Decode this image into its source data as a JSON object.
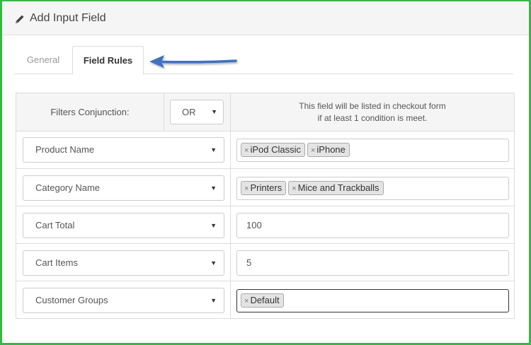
{
  "header": {
    "title": "Add Input Field",
    "icon": "pencil-icon"
  },
  "tabs": [
    {
      "label": "General",
      "active": false
    },
    {
      "label": "Field Rules",
      "active": true
    }
  ],
  "colors": {
    "frame_border": "#3bb54a",
    "arrow": "#3f6fc1"
  },
  "conjunction": {
    "label": "Filters Conjunction:",
    "value": "OR",
    "note_line1": "This field will be listed in checkout form",
    "note_line2": "if at least 1 condition is meet."
  },
  "rules": [
    {
      "field": "Product Name",
      "tags": [
        "iPod Classic",
        "iPhone"
      ]
    },
    {
      "field": "Category Name",
      "tags": [
        "Printers",
        "Mice and Trackballs"
      ]
    },
    {
      "field": "Cart Total",
      "value": "100"
    },
    {
      "field": "Cart Items",
      "value": "5"
    },
    {
      "field": "Customer Groups",
      "tags": [
        "Default"
      ]
    }
  ],
  "tag_remove_glyph": "×"
}
